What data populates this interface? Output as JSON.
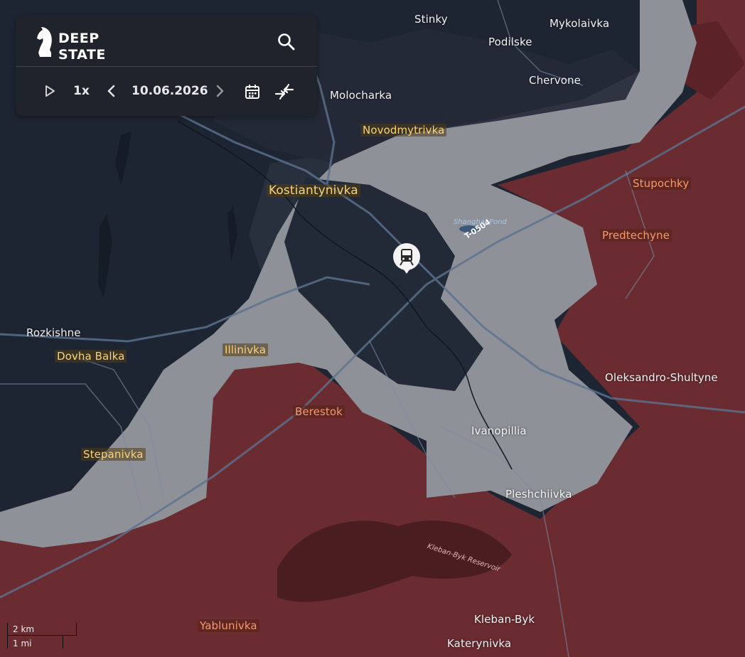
{
  "app": {
    "brand_line1": "DEEP",
    "brand_line2": "STATE",
    "accent_color": "#ffffff",
    "panel_color": "#1f232b"
  },
  "toolbar": {
    "play_icon": "play-icon",
    "speed": "1x",
    "prev_icon": "chevron-left-icon",
    "date": "10.06.2026",
    "next_icon": "chevron-right-icon",
    "calendar_icon": "calendar-icon",
    "compare_icon": "compare-arrows-icon",
    "search_icon": "search-icon"
  },
  "map": {
    "colors": {
      "ukraine_controlled": "#1e2532",
      "occupied": "#6e2e33",
      "contested_gray": "#8c8f96"
    },
    "places": {
      "stinky": "Stinky",
      "mykolaivka": "Mykolaivka",
      "podilske": "Podilske",
      "chervone": "Chervone",
      "molocharka": "Molocharka",
      "novodmytrivka": "Novodmytrivka",
      "kostiantynivka": "Kostiantynivka",
      "stupochky": "Stupochky",
      "predtechyne": "Predtechyne",
      "rozkishne": "Rozkishne",
      "dovha_balka": "Dovha Balka",
      "illinivka": "Illinivka",
      "oleksandro_shultyne": "Oleksandro-Shultyne",
      "berestok": "Berestok",
      "ivanopillia": "Ivanopillia",
      "stepanivka": "Stepanivka",
      "pleshchiivka": "Pleshchiivka",
      "kleban_byk": "Kleban-Byk",
      "yablunivka": "Yablunivka",
      "katerynivka": "Katerynivka"
    },
    "road_label": "T-0504",
    "water_label": "Shanghai Pond",
    "reservoir_label": "Kleban-Byk Reservoir",
    "marker_icon": "railway-station-icon"
  },
  "scale": {
    "km": "2 km",
    "mi": "1 mi"
  }
}
